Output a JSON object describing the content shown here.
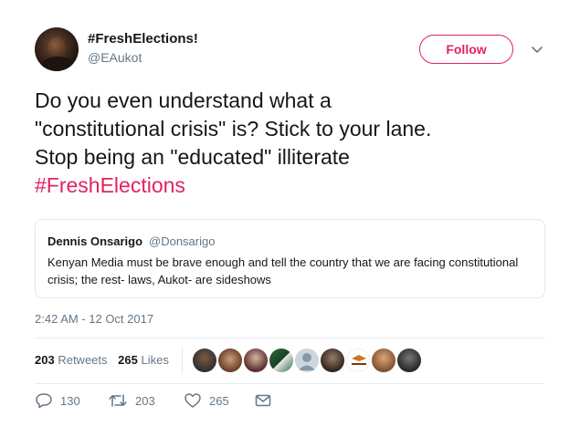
{
  "user": {
    "display_name": "#FreshElections!",
    "handle": "@EAukot"
  },
  "follow_button": {
    "label": "Follow"
  },
  "tweet": {
    "text_line1": "Do you even understand what a",
    "text_line2": "\"constitutional crisis\" is? Stick to your lane.",
    "text_line3": "Stop being an \"educated\" illiterate",
    "hashtag": "#FreshElections"
  },
  "quoted_tweet": {
    "author": "Dennis Onsarigo",
    "handle": "@Donsarigo",
    "text": "Kenyan Media must be brave enough and tell the country that we are facing constitutional crisis; the rest- laws, Aukot- are sideshows"
  },
  "timestamp": "2:42 AM - 12 Oct 2017",
  "stats": {
    "retweets_count": "203",
    "retweets_label": "Retweets",
    "likes_count": "265",
    "likes_label": "Likes"
  },
  "actions": {
    "replies": "130",
    "retweets": "203",
    "likes": "265"
  },
  "colors": {
    "accent": "#e0245e",
    "secondary_text": "#657786",
    "primary_text": "#14171a",
    "border": "#e1e8ed"
  }
}
